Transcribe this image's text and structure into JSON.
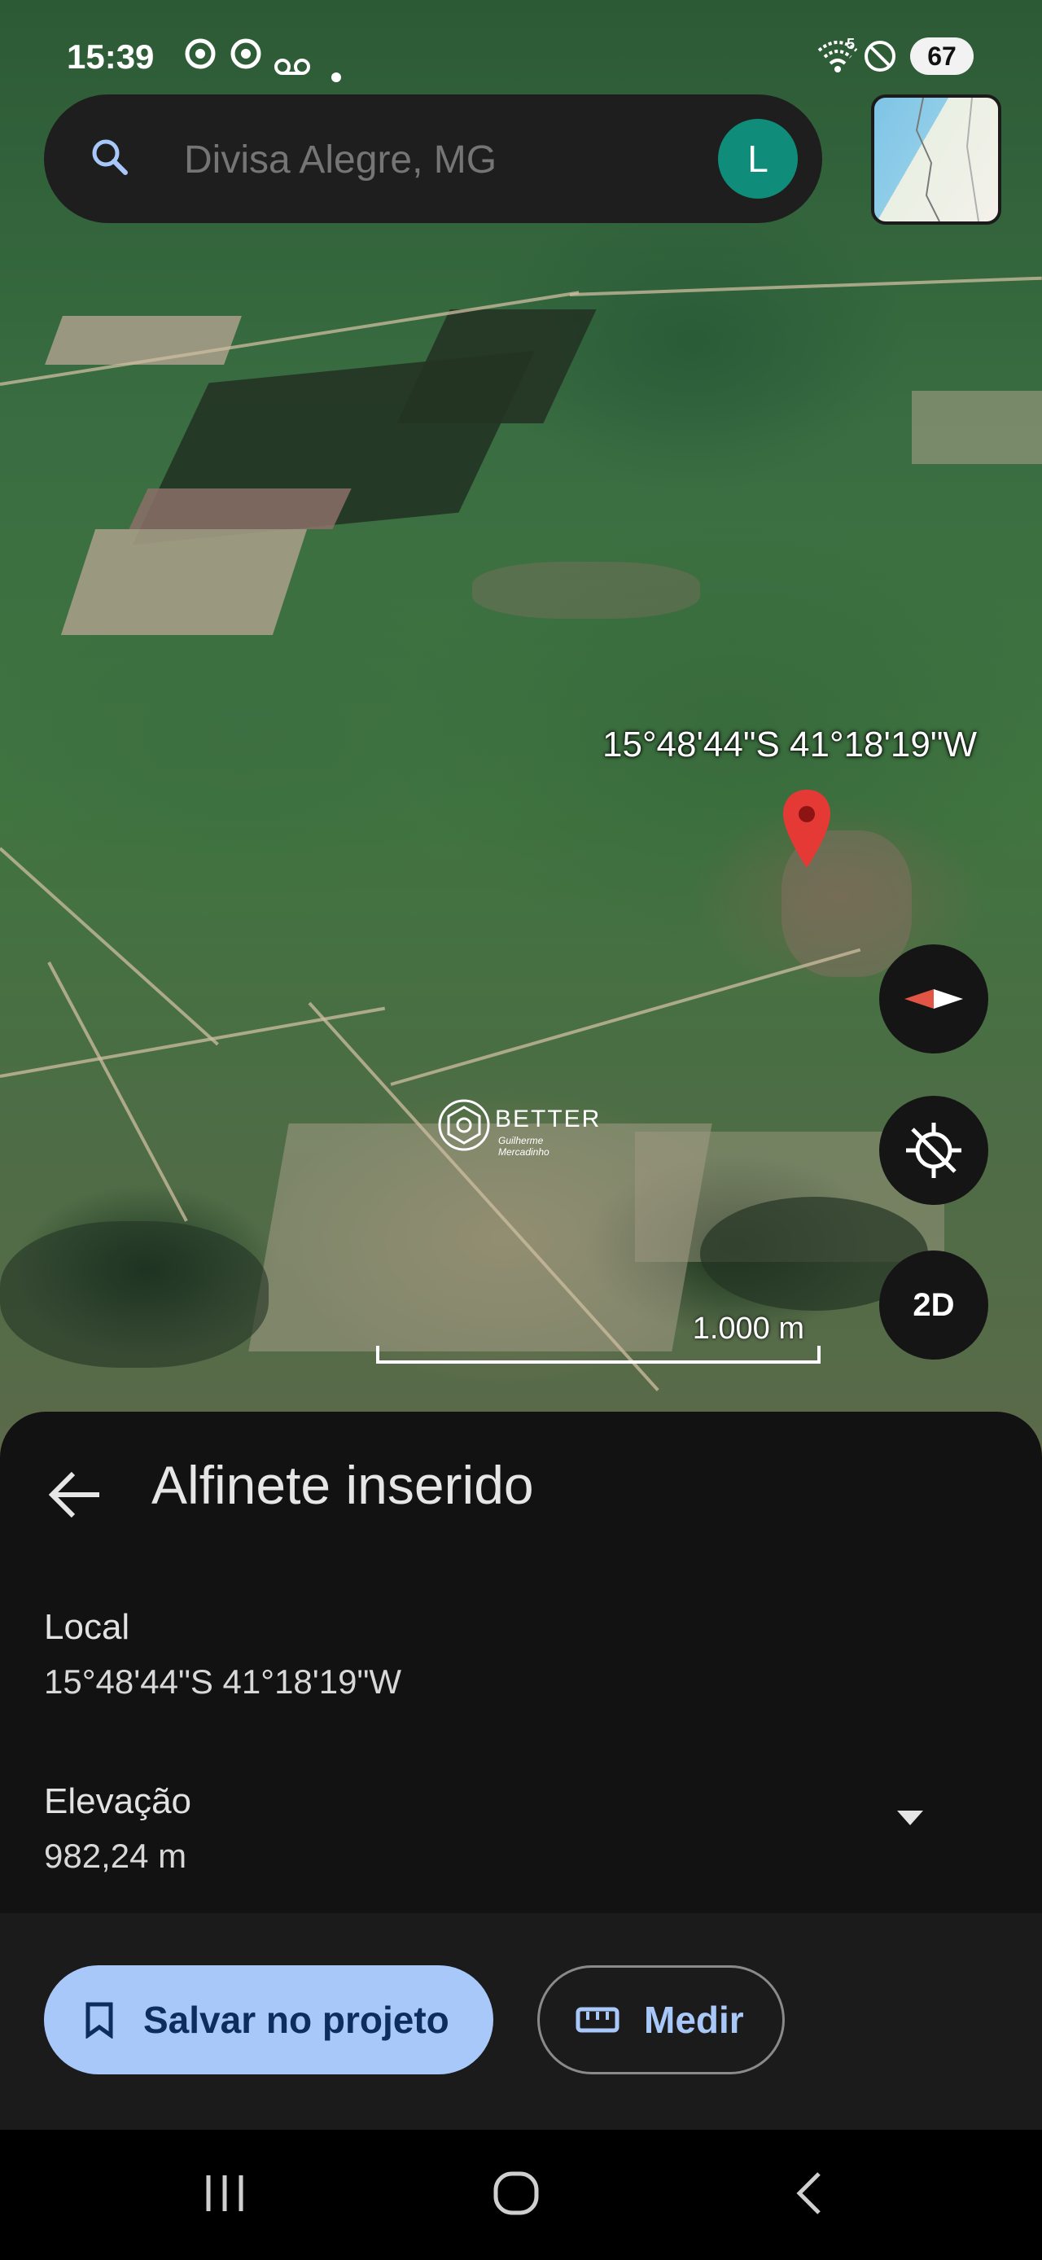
{
  "status_bar": {
    "time": "15:39",
    "notification_icons": [
      "chrome-icon",
      "chrome-icon",
      "voicemail-icon",
      "dot-icon"
    ],
    "wifi_badge": "5",
    "battery": "67"
  },
  "search": {
    "placeholder": "Divisa Alegre, MG",
    "avatar_letter": "L"
  },
  "map": {
    "pin_label": "15°48'44\"S 41°18'19\"W",
    "watermark_text": "BETTER",
    "watermark_sub": "Guilherme Mercadinho",
    "scale_label": "1.000 m",
    "mode_button": "2D"
  },
  "sheet": {
    "title": "Alfinete inserido",
    "location_label": "Local",
    "location_value": "15°48'44\"S 41°18'19\"W",
    "elevation_label": "Elevação",
    "elevation_value": "982,24 m"
  },
  "actions": {
    "save_label": "Salvar no projeto",
    "measure_label": "Medir"
  },
  "colors": {
    "accent": "#a8c8fa",
    "pin": "#e53935",
    "avatar": "#0f8d7a"
  }
}
